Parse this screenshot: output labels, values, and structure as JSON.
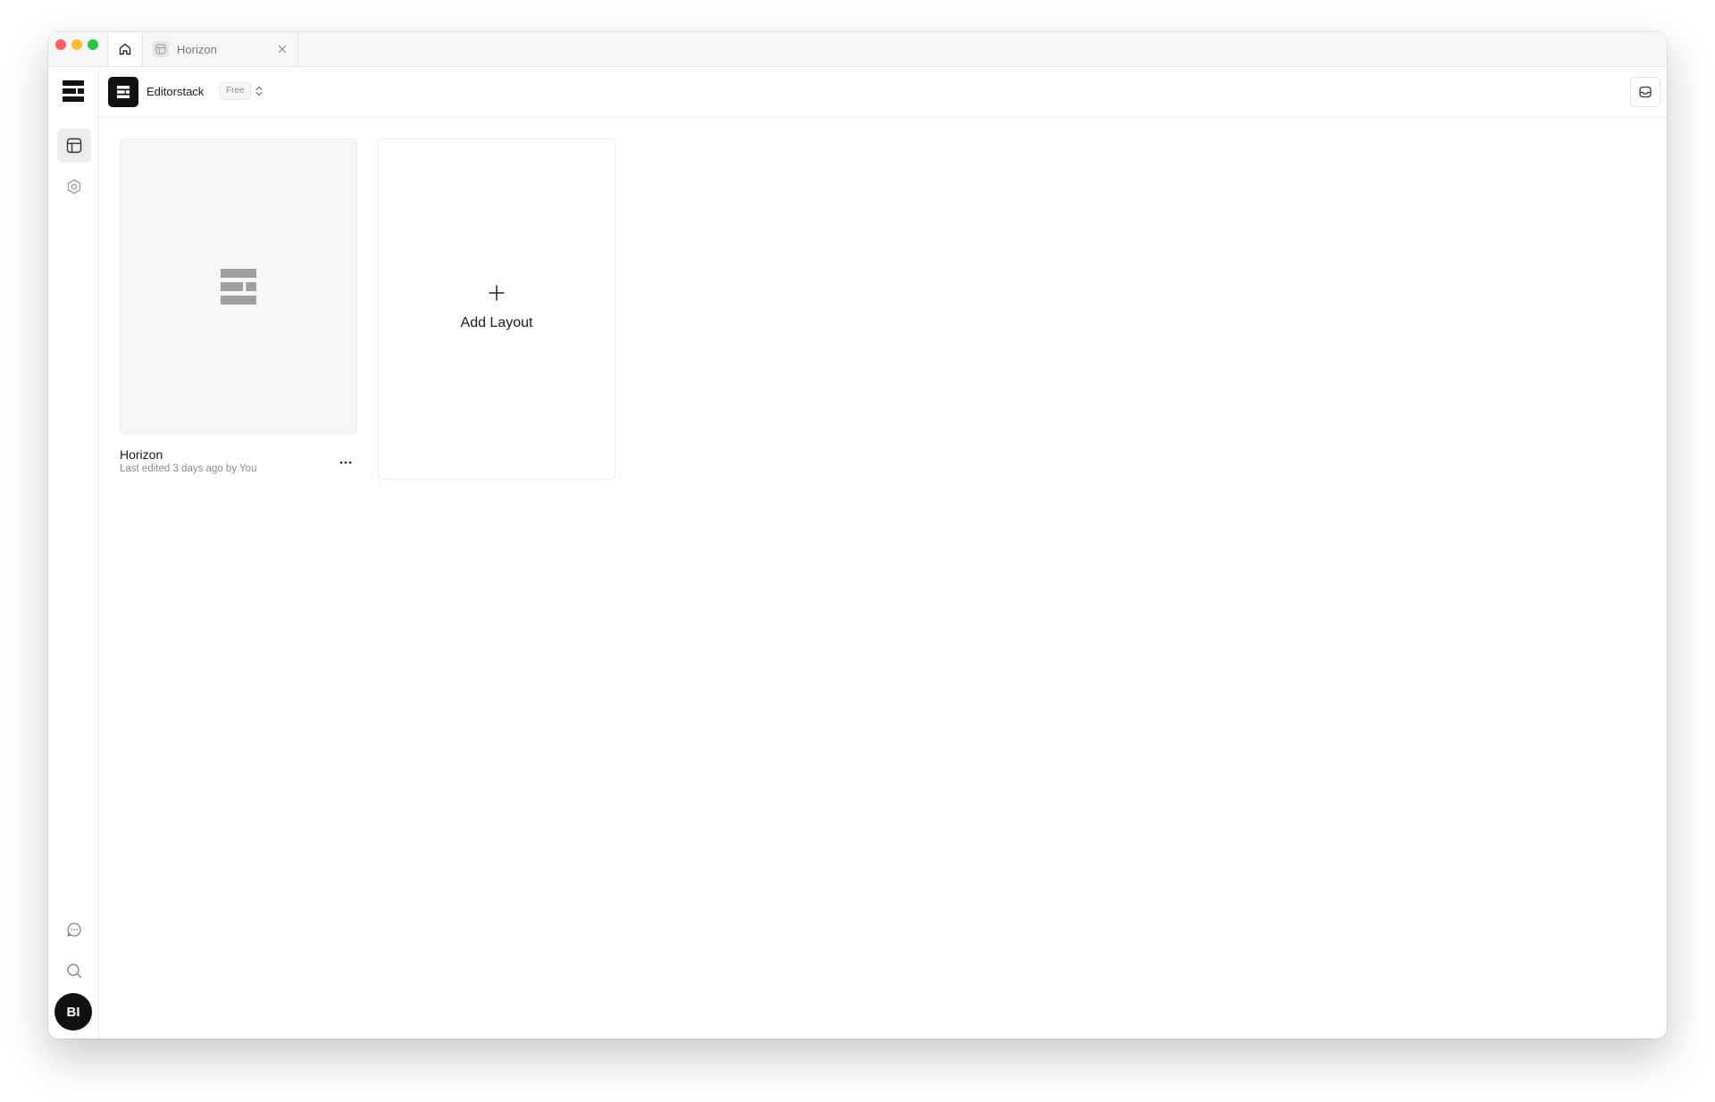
{
  "window": {
    "traffic_lights": [
      "close",
      "minimize",
      "zoom"
    ],
    "tabs": [
      {
        "icon": "home-icon"
      },
      {
        "label": "Horizon",
        "icon": "layout-icon"
      }
    ]
  },
  "sidebar": {
    "logo_icon": "editorstack-logo-icon",
    "top_items": [
      {
        "icon": "layout-icon",
        "active": true
      },
      {
        "icon": "settings-icon",
        "active": false
      }
    ],
    "bottom_items": [
      {
        "icon": "chat-icon"
      },
      {
        "icon": "search-icon"
      }
    ],
    "avatar": {
      "initials": "BI"
    }
  },
  "header": {
    "workspace_name": "Editorstack",
    "plan_badge": "Free",
    "inbox_icon": "inbox-icon"
  },
  "main": {
    "layouts": [
      {
        "title": "Horizon",
        "meta": "Last edited 3 days ago by You",
        "more_label": "..."
      }
    ],
    "add_card": {
      "label": "Add Layout",
      "icon": "plus-icon"
    }
  },
  "colors": {
    "accent_dark": "#111111",
    "border": "#ececec",
    "muted_text": "#8a8a8a"
  }
}
